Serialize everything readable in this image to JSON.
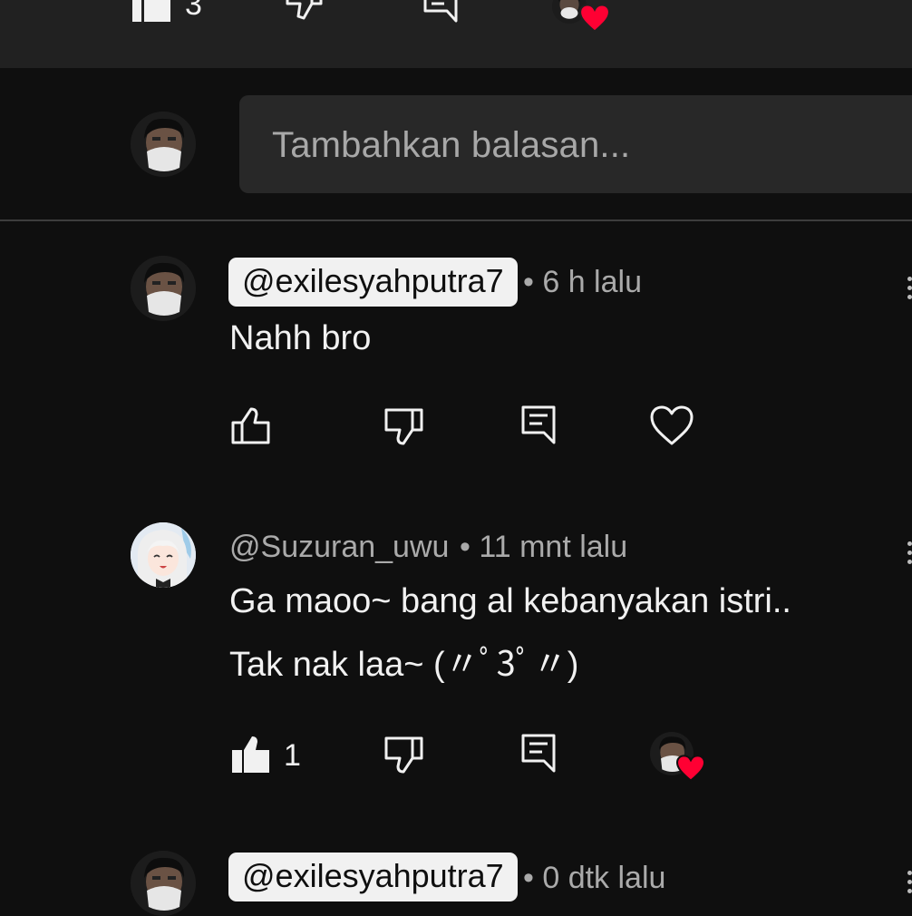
{
  "previous_comment": {
    "like_count": "3"
  },
  "reply_input": {
    "placeholder": "Tambahkan balasan..."
  },
  "comments": [
    {
      "handle": "@exilesyahputra7",
      "time": "• 6 h lalu",
      "text_lines": [
        "Nahh bro"
      ],
      "like_count": "",
      "liked": false,
      "creator_hearted": false
    },
    {
      "handle": "@Suzuran_uwu",
      "time": "• 11 mnt lalu",
      "text_lines": [
        "Ga maoo~ bang al kebanyakan istri..",
        "Tak nak laa~ (〃ﾟ3ﾟ〃)"
      ],
      "like_count": "1",
      "liked": true,
      "creator_hearted": true
    },
    {
      "handle": "@exilesyahputra7",
      "time": "• 0 dtk lalu"
    }
  ],
  "icons": [
    "thumb-up-icon",
    "thumb-down-icon",
    "reply-comment-icon",
    "heart-outline-icon",
    "heart-filled-icon",
    "more-vert-icon"
  ],
  "colors": {
    "background": "#0f0f0f",
    "surface": "#212121",
    "input": "#282828",
    "heart": "#ff0033",
    "meta": "#aaaaaa"
  }
}
